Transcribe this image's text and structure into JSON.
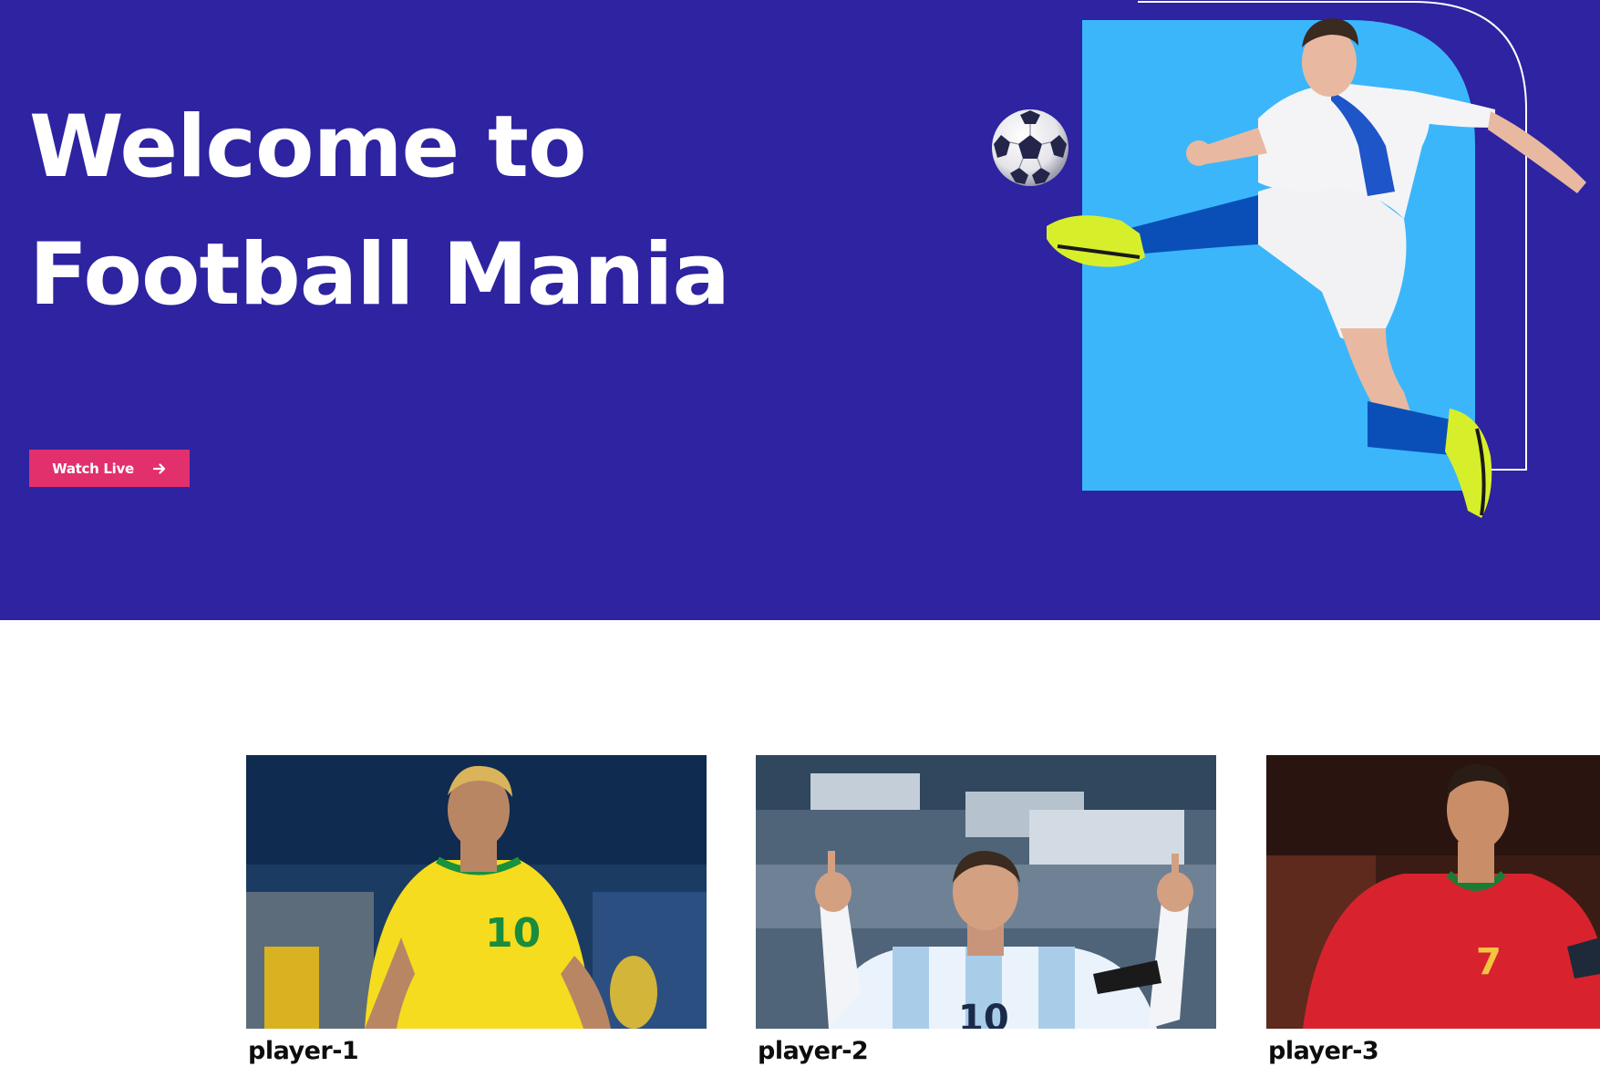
{
  "hero": {
    "title": "Welcome to Football Mania",
    "watch_button_label": "Watch Live",
    "watch_button_icon": "arrow-right-icon",
    "hero_image": "football-player-kicking-image",
    "ball_icon": "soccer-ball-icon"
  },
  "colors": {
    "hero_background": "#2e23a0",
    "accent_panel": "#3bb6fb",
    "button": "#e1306c",
    "text_light": "#ffffff",
    "text_dark": "#0d0d0d"
  },
  "players": [
    {
      "name": "player-1",
      "jersey": "10",
      "kit": "yellow"
    },
    {
      "name": "player-2",
      "jersey": "10",
      "kit": "sky-blue-white"
    },
    {
      "name": "player-3",
      "jersey": "7",
      "kit": "red"
    }
  ]
}
